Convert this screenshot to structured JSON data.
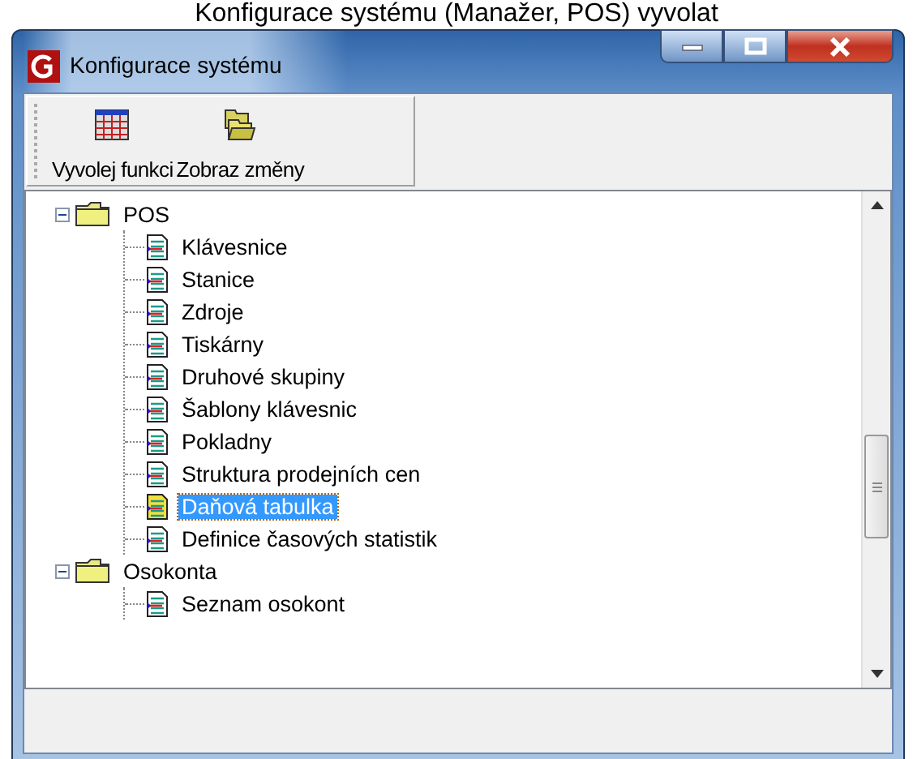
{
  "caption": "Konfigurace systému (Manažer, POS) vyvolat",
  "window": {
    "title": "Konfigurace systému"
  },
  "toolbar": [
    {
      "label": "Vyvolej funkci",
      "kind": "calendar"
    },
    {
      "label": "Zobraz změny",
      "kind": "folders"
    }
  ],
  "tree": [
    {
      "label": "POS",
      "kind": "folder",
      "expanded": true,
      "children": [
        {
          "label": "Klávesnice",
          "kind": "document",
          "selected": false
        },
        {
          "label": "Stanice",
          "kind": "document",
          "selected": false
        },
        {
          "label": "Zdroje",
          "kind": "document",
          "selected": false
        },
        {
          "label": "Tiskárny",
          "kind": "document",
          "selected": false
        },
        {
          "label": "Druhové skupiny",
          "kind": "document",
          "selected": false
        },
        {
          "label": "Šablony klávesnic",
          "kind": "document",
          "selected": false
        },
        {
          "label": "Pokladny",
          "kind": "document",
          "selected": false
        },
        {
          "label": "Struktura prodejních cen",
          "kind": "document",
          "selected": false
        },
        {
          "label": "Daňová tabulka",
          "kind": "document",
          "selected": true
        },
        {
          "label": "Definice časových statistik",
          "kind": "document",
          "selected": false
        }
      ]
    },
    {
      "label": "Osokonta",
      "kind": "folder",
      "expanded": true,
      "children": [
        {
          "label": "Seznam osokont",
          "kind": "document",
          "selected": false
        }
      ]
    }
  ]
}
